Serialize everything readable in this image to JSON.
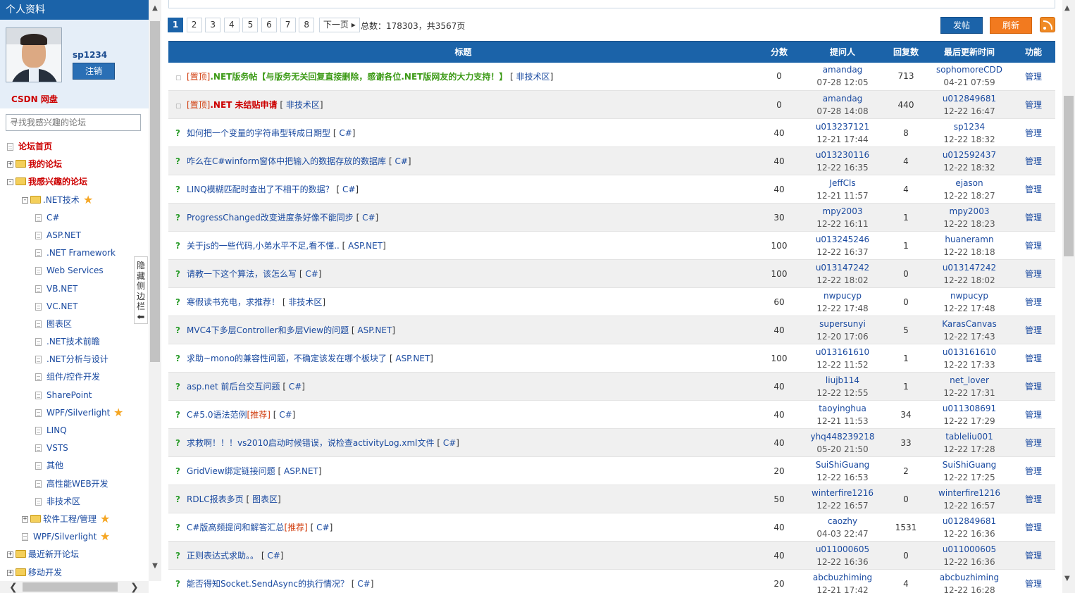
{
  "sidebar": {
    "title": "个人资料",
    "username": "sp1234",
    "logout_label": "注销",
    "netdisk_label": "CSDN 网盘",
    "search_placeholder": "寻找我感兴趣的论坛",
    "toggle_label": "隐藏侧边栏",
    "tree": [
      {
        "label": "论坛首页",
        "level": 0,
        "kind": "doc",
        "style": "red"
      },
      {
        "label": "我的论坛",
        "level": 0,
        "kind": "folder",
        "style": "red",
        "expander": "+"
      },
      {
        "label": "我感兴趣的论坛",
        "level": 0,
        "kind": "folder",
        "style": "red",
        "expander": "-"
      },
      {
        "label": ".NET技术",
        "level": 1,
        "kind": "folder",
        "style": "normal",
        "expander": "-",
        "star": true
      },
      {
        "label": "C#",
        "level": 2,
        "kind": "doc",
        "style": "blue"
      },
      {
        "label": "ASP.NET",
        "level": 2,
        "kind": "doc",
        "style": "blue"
      },
      {
        "label": ".NET Framework",
        "level": 2,
        "kind": "doc",
        "style": "blue"
      },
      {
        "label": "Web Services",
        "level": 2,
        "kind": "doc",
        "style": "blue"
      },
      {
        "label": "VB.NET",
        "level": 2,
        "kind": "doc",
        "style": "blue"
      },
      {
        "label": "VC.NET",
        "level": 2,
        "kind": "doc",
        "style": "blue"
      },
      {
        "label": "图表区",
        "level": 2,
        "kind": "doc",
        "style": "blue"
      },
      {
        "label": ".NET技术前瞻",
        "level": 2,
        "kind": "doc",
        "style": "blue"
      },
      {
        "label": ".NET分析与设计",
        "level": 2,
        "kind": "doc",
        "style": "blue"
      },
      {
        "label": "组件/控件开发",
        "level": 2,
        "kind": "doc",
        "style": "blue"
      },
      {
        "label": "SharePoint",
        "level": 2,
        "kind": "doc",
        "style": "blue"
      },
      {
        "label": "WPF/Silverlight",
        "level": 2,
        "kind": "doc",
        "style": "blue",
        "star": true
      },
      {
        "label": "LINQ",
        "level": 2,
        "kind": "doc",
        "style": "blue"
      },
      {
        "label": "VSTS",
        "level": 2,
        "kind": "doc",
        "style": "blue"
      },
      {
        "label": "其他",
        "level": 2,
        "kind": "doc",
        "style": "blue"
      },
      {
        "label": "高性能WEB开发",
        "level": 2,
        "kind": "doc",
        "style": "blue"
      },
      {
        "label": "非技术区",
        "level": 2,
        "kind": "doc",
        "style": "blue"
      },
      {
        "label": "软件工程/管理",
        "level": 1,
        "kind": "folder",
        "style": "normal",
        "expander": "+",
        "star": true
      },
      {
        "label": "WPF/Silverlight",
        "level": 1,
        "kind": "doc",
        "style": "blue",
        "star": true
      },
      {
        "label": "最近新开论坛",
        "level": 0,
        "kind": "folder",
        "style": "normal",
        "expander": "+"
      },
      {
        "label": "移动开发",
        "level": 0,
        "kind": "folder",
        "style": "normal",
        "expander": "+"
      }
    ]
  },
  "pager": {
    "pages": [
      "1",
      "2",
      "3",
      "4",
      "5",
      "6",
      "7",
      "8"
    ],
    "current": "1",
    "next_label": "下一页",
    "total_text": "总数：178303，共3567页"
  },
  "actions": {
    "post_label": "发帖",
    "refresh_label": "刷新"
  },
  "table": {
    "headers": {
      "title": "标题",
      "score": "分数",
      "asker": "提问人",
      "replies": "回复数",
      "last_update": "最后更新时间",
      "action": "功能"
    },
    "rows": [
      {
        "sticky": true,
        "prefix": "[置顶]",
        "title": ".NET版务帖【与版务无关回复直接删除，感谢各位.NET版网友的大力支持！】",
        "title_style": "green",
        "board": "非技术区",
        "score": "0",
        "asker": "amandag",
        "asked": "07-28 12:05",
        "replies": "713",
        "last_user": "sophomoreCDD",
        "last_time": "04-21 07:59",
        "action": "管理"
      },
      {
        "sticky": true,
        "prefix": "[置顶]",
        "title": ".NET 未结贴申请",
        "title_style": "red",
        "board": "非技术区",
        "score": "0",
        "asker": "amandag",
        "asked": "07-28 14:08",
        "replies": "440",
        "last_user": "u012849681",
        "last_time": "12-22 16:47",
        "action": "管理"
      },
      {
        "title": "如何把一个变量的字符串型转成日期型",
        "board": "C#",
        "score": "40",
        "asker": "u013237121",
        "asked": "12-21 17:44",
        "replies": "8",
        "last_user": "sp1234",
        "last_time": "12-22 18:32",
        "action": "管理"
      },
      {
        "title": "咋么在C#winform窗体中把输入的数据存放的数据库",
        "board": "C#",
        "score": "40",
        "asker": "u013230116",
        "asked": "12-22 16:35",
        "replies": "4",
        "last_user": "u012592437",
        "last_time": "12-22 18:32",
        "action": "管理"
      },
      {
        "title": "LINQ模糊匹配时查出了不相干的数据？",
        "board": "C#",
        "score": "40",
        "asker": "JeffCls",
        "asked": "12-21 11:57",
        "replies": "4",
        "last_user": "ejason",
        "last_time": "12-22 18:27",
        "action": "管理"
      },
      {
        "title": "ProgressChanged改变进度条好像不能同步",
        "board": "C#",
        "score": "30",
        "asker": "mpy2003",
        "asked": "12-22 16:11",
        "replies": "1",
        "last_user": "mpy2003",
        "last_time": "12-22 18:23",
        "action": "管理"
      },
      {
        "title": "关于js的一些代码,小弟水平不足,看不懂..",
        "board": "ASP.NET",
        "score": "100",
        "asker": "u013245246",
        "asked": "12-22 16:37",
        "replies": "1",
        "last_user": "huaneramn",
        "last_time": "12-22 18:18",
        "action": "管理"
      },
      {
        "title": "请教一下这个算法，该怎么写",
        "board": "C#",
        "score": "100",
        "asker": "u013147242",
        "asked": "12-22 18:02",
        "replies": "0",
        "last_user": "u013147242",
        "last_time": "12-22 18:02",
        "action": "管理"
      },
      {
        "title": "寒假读书充电，求推荐！",
        "board": "非技术区",
        "score": "60",
        "asker": "nwpucyp",
        "asked": "12-22 17:48",
        "replies": "0",
        "last_user": "nwpucyp",
        "last_time": "12-22 17:48",
        "action": "管理"
      },
      {
        "title": "MVC4下多层Controller和多层View的问题",
        "board": "ASP.NET",
        "score": "40",
        "asker": "supersunyi",
        "asked": "12-20 17:06",
        "replies": "5",
        "last_user": "KarasCanvas",
        "last_time": "12-22 17:43",
        "action": "管理"
      },
      {
        "title": "求助~mono的兼容性问题，不确定该发在哪个板块了",
        "board": "ASP.NET",
        "score": "100",
        "asker": "u013161610",
        "asked": "12-22 11:52",
        "replies": "1",
        "last_user": "u013161610",
        "last_time": "12-22 17:33",
        "action": "管理"
      },
      {
        "title": "asp.net 前后台交互问题",
        "board": "C#",
        "score": "40",
        "asker": "liujb114",
        "asked": "12-22 12:55",
        "replies": "1",
        "last_user": "net_lover",
        "last_time": "12-22 17:31",
        "action": "管理"
      },
      {
        "title": "C#5.0语法范例",
        "tag": "[推荐]",
        "board": "C#",
        "score": "40",
        "asker": "taoyinghua",
        "asked": "12-21 11:53",
        "replies": "34",
        "last_user": "u011308691",
        "last_time": "12-22 17:29",
        "action": "管理"
      },
      {
        "title": "求救啊！！！vs2010启动时候错误，说检查activityLog.xml文件",
        "board": "C#",
        "score": "40",
        "asker": "yhq448239218",
        "asked": "05-20 21:50",
        "replies": "33",
        "last_user": "tableliu001",
        "last_time": "12-22 17:28",
        "action": "管理"
      },
      {
        "title": "GridView绑定链接问题",
        "board": "ASP.NET",
        "score": "20",
        "asker": "SuiShiGuang",
        "asked": "12-22 16:53",
        "replies": "2",
        "last_user": "SuiShiGuang",
        "last_time": "12-22 17:25",
        "action": "管理"
      },
      {
        "title": "RDLC报表多页",
        "board": "图表区",
        "score": "50",
        "asker": "winterfire1216",
        "asked": "12-22 16:57",
        "replies": "0",
        "last_user": "winterfire1216",
        "last_time": "12-22 16:57",
        "action": "管理"
      },
      {
        "title": "C#版高频提问和解答汇总",
        "tag": "[推荐]",
        "board": "C#",
        "score": "40",
        "asker": "caozhy",
        "asked": "04-03 22:47",
        "replies": "1531",
        "last_user": "u012849681",
        "last_time": "12-22 16:36",
        "action": "管理"
      },
      {
        "title": "正则表达式求助。。",
        "board": "C#",
        "score": "40",
        "asker": "u011000605",
        "asked": "12-22 16:36",
        "replies": "0",
        "last_user": "u011000605",
        "last_time": "12-22 16:36",
        "action": "管理"
      },
      {
        "title": "能否得知Socket.SendAsync的执行情况？",
        "board": "C#",
        "score": "20",
        "asker": "abcbuzhiming",
        "asked": "12-21 17:42",
        "replies": "4",
        "last_user": "abcbuzhiming",
        "last_time": "12-22 16:28",
        "action": "管理"
      }
    ]
  }
}
